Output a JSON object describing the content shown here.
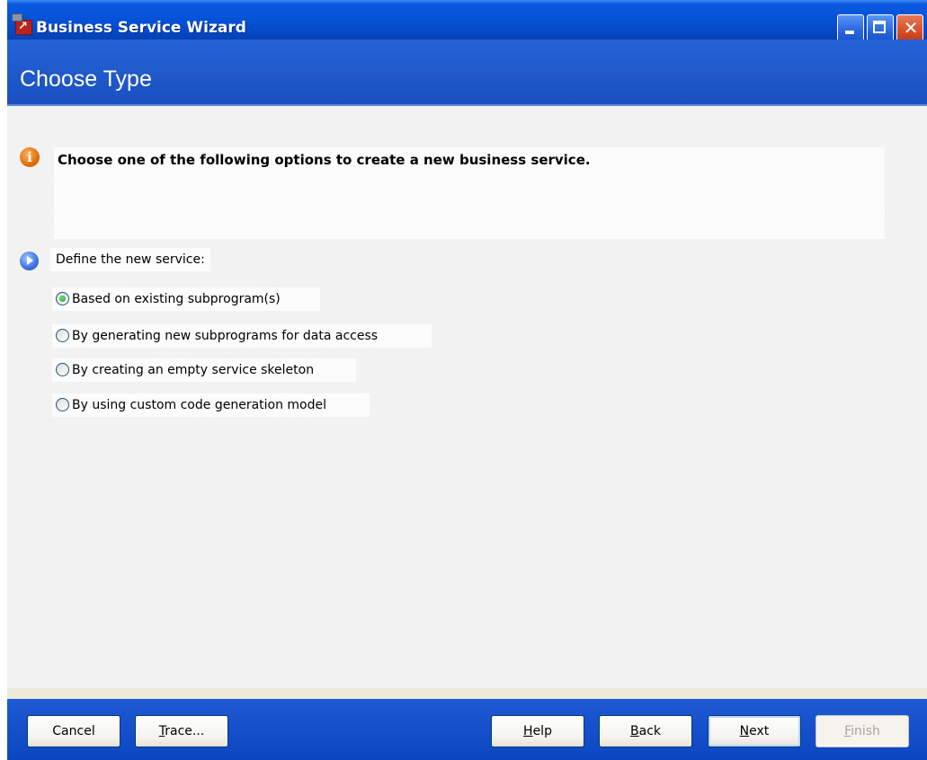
{
  "window": {
    "title": "Business Service Wizard"
  },
  "banner": {
    "title": "Choose Type"
  },
  "info": {
    "text": "Choose one of the following options to create a new business service."
  },
  "section": {
    "label": "Define the new service:"
  },
  "options": [
    {
      "label": "Based on existing subprogram(s)",
      "checked": true
    },
    {
      "label": "By generating new subprograms for data access",
      "checked": false
    },
    {
      "label": "By creating an empty service skeleton",
      "checked": false
    },
    {
      "label": "By using custom code generation model",
      "checked": false
    }
  ],
  "buttons": {
    "cancel": "Cancel",
    "trace_mnemonic": "T",
    "trace_rest": "race...",
    "help_mnemonic": "H",
    "help_rest": "elp",
    "back_mnemonic": "B",
    "back_rest": "ack",
    "next_mnemonic": "N",
    "next_rest": "ext",
    "finish_mnemonic": "F",
    "finish_rest": "inish"
  },
  "colors": {
    "titlebar": "#0552d6",
    "banner": "#2563d6",
    "footer": "#1e5ad4",
    "radio_checked": "#21a121"
  },
  "icons": {
    "app": "wizard-app-icon",
    "info": "info-icon",
    "section": "arrow-right-circle-icon"
  }
}
